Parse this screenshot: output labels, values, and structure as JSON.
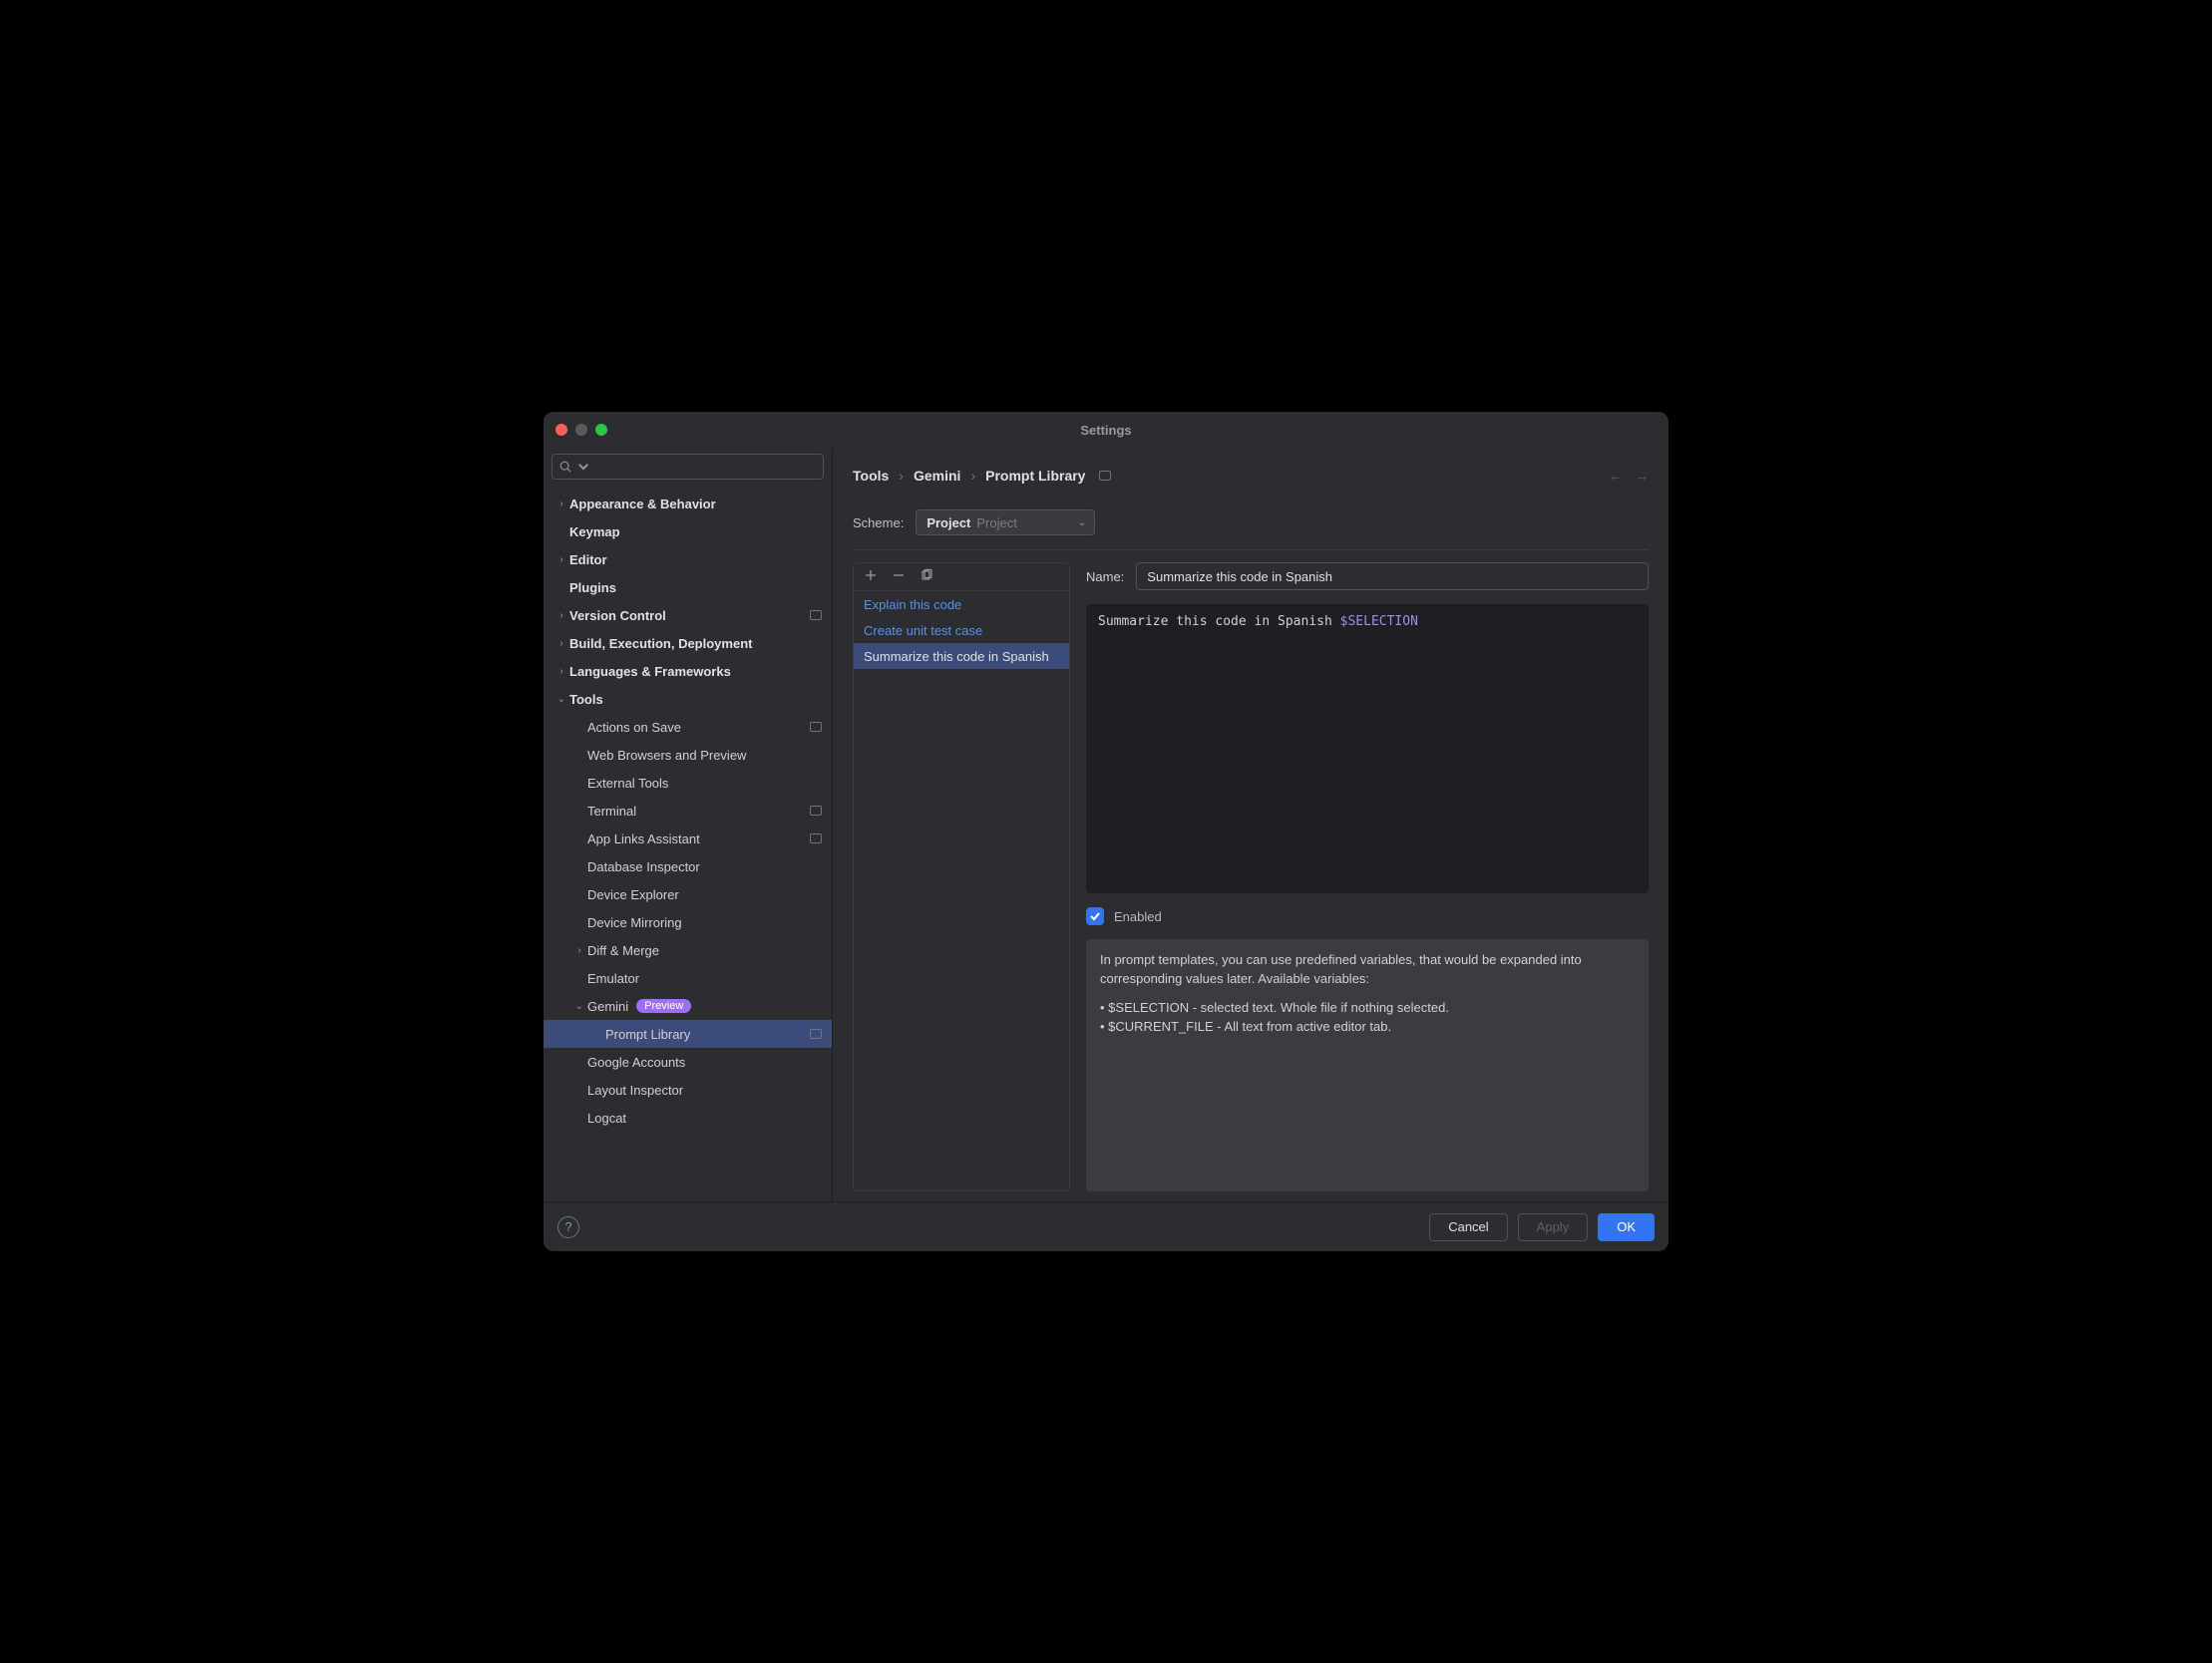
{
  "window": {
    "title": "Settings"
  },
  "search": {
    "placeholder": ""
  },
  "sidebar": {
    "items": [
      {
        "label": "Appearance & Behavior",
        "expandable": true,
        "expanded": false
      },
      {
        "label": "Keymap",
        "expandable": false
      },
      {
        "label": "Editor",
        "expandable": true,
        "expanded": false
      },
      {
        "label": "Plugins",
        "expandable": false
      },
      {
        "label": "Version Control",
        "expandable": true,
        "expanded": false,
        "projIcon": true
      },
      {
        "label": "Build, Execution, Deployment",
        "expandable": true,
        "expanded": false
      },
      {
        "label": "Languages & Frameworks",
        "expandable": true,
        "expanded": false
      },
      {
        "label": "Tools",
        "expandable": true,
        "expanded": true,
        "children": [
          {
            "label": "Actions on Save",
            "projIcon": true
          },
          {
            "label": "Web Browsers and Preview"
          },
          {
            "label": "External Tools"
          },
          {
            "label": "Terminal",
            "projIcon": true
          },
          {
            "label": "App Links Assistant",
            "projIcon": true
          },
          {
            "label": "Database Inspector"
          },
          {
            "label": "Device Explorer"
          },
          {
            "label": "Device Mirroring"
          },
          {
            "label": "Diff & Merge",
            "expandable": true,
            "expanded": false
          },
          {
            "label": "Emulator"
          },
          {
            "label": "Gemini",
            "expandable": true,
            "expanded": true,
            "badge": "Preview",
            "children": [
              {
                "label": "Prompt Library",
                "selected": true,
                "projIcon": true
              }
            ]
          },
          {
            "label": "Google Accounts"
          },
          {
            "label": "Layout Inspector"
          },
          {
            "label": "Logcat"
          }
        ]
      }
    ]
  },
  "breadcrumb": {
    "parts": [
      "Tools",
      "Gemini",
      "Prompt Library"
    ]
  },
  "scheme": {
    "label": "Scheme:",
    "valueStrong": "Project",
    "valueDim": "Project"
  },
  "promptList": {
    "items": [
      {
        "label": "Explain this code"
      },
      {
        "label": "Create unit test case"
      },
      {
        "label": "Summarize this code in Spanish",
        "selected": true
      }
    ]
  },
  "detail": {
    "nameLabel": "Name:",
    "nameValue": "Summarize this code in Spanish",
    "promptText": "Summarize this code in Spanish ",
    "promptVar": "$SELECTION",
    "enabledLabel": "Enabled",
    "enabled": true,
    "helpIntro": "In prompt templates, you can use predefined variables, that would be expanded into corresponding values later. Available variables:",
    "helpBullet1": "• $SELECTION - selected text. Whole file if nothing selected.",
    "helpBullet2": "• $CURRENT_FILE - All text from active editor tab."
  },
  "footer": {
    "cancel": "Cancel",
    "apply": "Apply",
    "ok": "OK"
  }
}
